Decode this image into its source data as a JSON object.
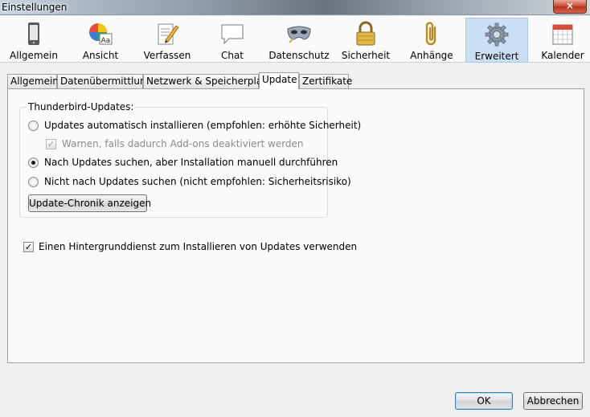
{
  "window": {
    "title": "Einstellungen",
    "close_label": "×"
  },
  "toolbar": {
    "items": [
      {
        "label": "Allgemein",
        "icon": "phone-icon"
      },
      {
        "label": "Ansicht",
        "icon": "color-font-icon"
      },
      {
        "label": "Verfassen",
        "icon": "pencil-note-icon"
      },
      {
        "label": "Chat",
        "icon": "speech-bubble-icon"
      },
      {
        "label": "Datenschutz",
        "icon": "mask-icon"
      },
      {
        "label": "Sicherheit",
        "icon": "padlock-icon"
      },
      {
        "label": "Anhänge",
        "icon": "paperclip-icon"
      },
      {
        "label": "Erweitert",
        "icon": "gear-icon"
      },
      {
        "label": "Kalender",
        "icon": "calendar-icon"
      }
    ],
    "active": "Erweitert"
  },
  "tabs": {
    "items": [
      "Allgemein",
      "Datenübermittlung",
      "Netzwerk & Speicherplatz",
      "Update",
      "Zertifikate"
    ],
    "active": "Update"
  },
  "updates": {
    "group_title": "Thunderbird-Updates:",
    "auto_install": "Updates automatisch installieren (empfohlen: erhöhte Sicherheit)",
    "warn_addons": "Warnen, falls dadurch Add-ons deaktiviert werden",
    "manual_install": "Nach Updates suchen, aber Installation manuell durchführen",
    "never_check": "Nicht nach Updates suchen (nicht empfohlen: Sicherheitsrisiko)",
    "selected": "manual_install",
    "warn_addons_checked": true,
    "history_button": "Update-Chronik anzeigen"
  },
  "background_service": {
    "label": "Einen Hintergrunddienst zum Installieren von Updates verwenden",
    "checked": true
  },
  "footer": {
    "ok": "OK",
    "cancel": "Abbrechen"
  },
  "colors": {
    "active_toolbar": "#c9dff5",
    "default_button_border": "#3c7fb1"
  }
}
